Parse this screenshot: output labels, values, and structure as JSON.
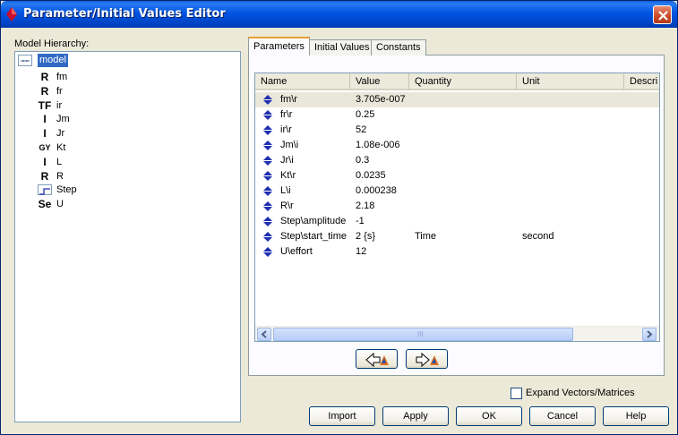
{
  "window": {
    "title": "Parameter/Initial Values Editor"
  },
  "hierarchy": {
    "label": "Model Hierarchy:",
    "root": "model",
    "items": [
      {
        "symbol": "R",
        "name": "fm"
      },
      {
        "symbol": "R",
        "name": "fr"
      },
      {
        "symbol": "TF",
        "name": "ir"
      },
      {
        "symbol": "I",
        "name": "Jm"
      },
      {
        "symbol": "I",
        "name": "Jr"
      },
      {
        "symbol": "GY",
        "name": "Kt"
      },
      {
        "symbol": "I",
        "name": "L"
      },
      {
        "symbol": "R",
        "name": "R"
      },
      {
        "symbol": "",
        "name": "Step"
      },
      {
        "symbol": "Se",
        "name": "U"
      }
    ]
  },
  "tabs": [
    "Parameters",
    "Initial Values",
    "Constants"
  ],
  "active_tab": "Parameters",
  "table": {
    "columns": [
      "Name",
      "Value",
      "Quantity",
      "Unit",
      "Descri"
    ],
    "rows": [
      {
        "name": "fm\\r",
        "value": "3.705e-007",
        "quantity": "",
        "unit": ""
      },
      {
        "name": "fr\\r",
        "value": "0.25",
        "quantity": "",
        "unit": ""
      },
      {
        "name": "ir\\r",
        "value": "52",
        "quantity": "",
        "unit": ""
      },
      {
        "name": "Jm\\i",
        "value": "1.08e-006",
        "quantity": "",
        "unit": ""
      },
      {
        "name": "Jr\\i",
        "value": "0.3",
        "quantity": "",
        "unit": ""
      },
      {
        "name": "Kt\\r",
        "value": "0.0235",
        "quantity": "",
        "unit": ""
      },
      {
        "name": "L\\i",
        "value": "0.000238",
        "quantity": "",
        "unit": ""
      },
      {
        "name": "R\\r",
        "value": "2.18",
        "quantity": "",
        "unit": ""
      },
      {
        "name": "Step\\amplitude",
        "value": "-1",
        "quantity": "",
        "unit": ""
      },
      {
        "name": "Step\\start_time",
        "value": "2 {s}",
        "quantity": "Time",
        "unit": "second"
      },
      {
        "name": "U\\effort",
        "value": "12",
        "quantity": "",
        "unit": ""
      }
    ]
  },
  "scrollbar": {
    "grip": "III"
  },
  "expand_checkbox": {
    "label": "Expand Vectors/Matrices",
    "checked": false
  },
  "buttons": {
    "import": "Import",
    "apply": "Apply",
    "ok": "OK",
    "cancel": "Cancel",
    "help": "Help"
  },
  "colors": {
    "titlebar": "#0054e3",
    "selection": "#316ac5",
    "row_icon": "#1f2fb0",
    "tab_accent": "#e8a033"
  }
}
